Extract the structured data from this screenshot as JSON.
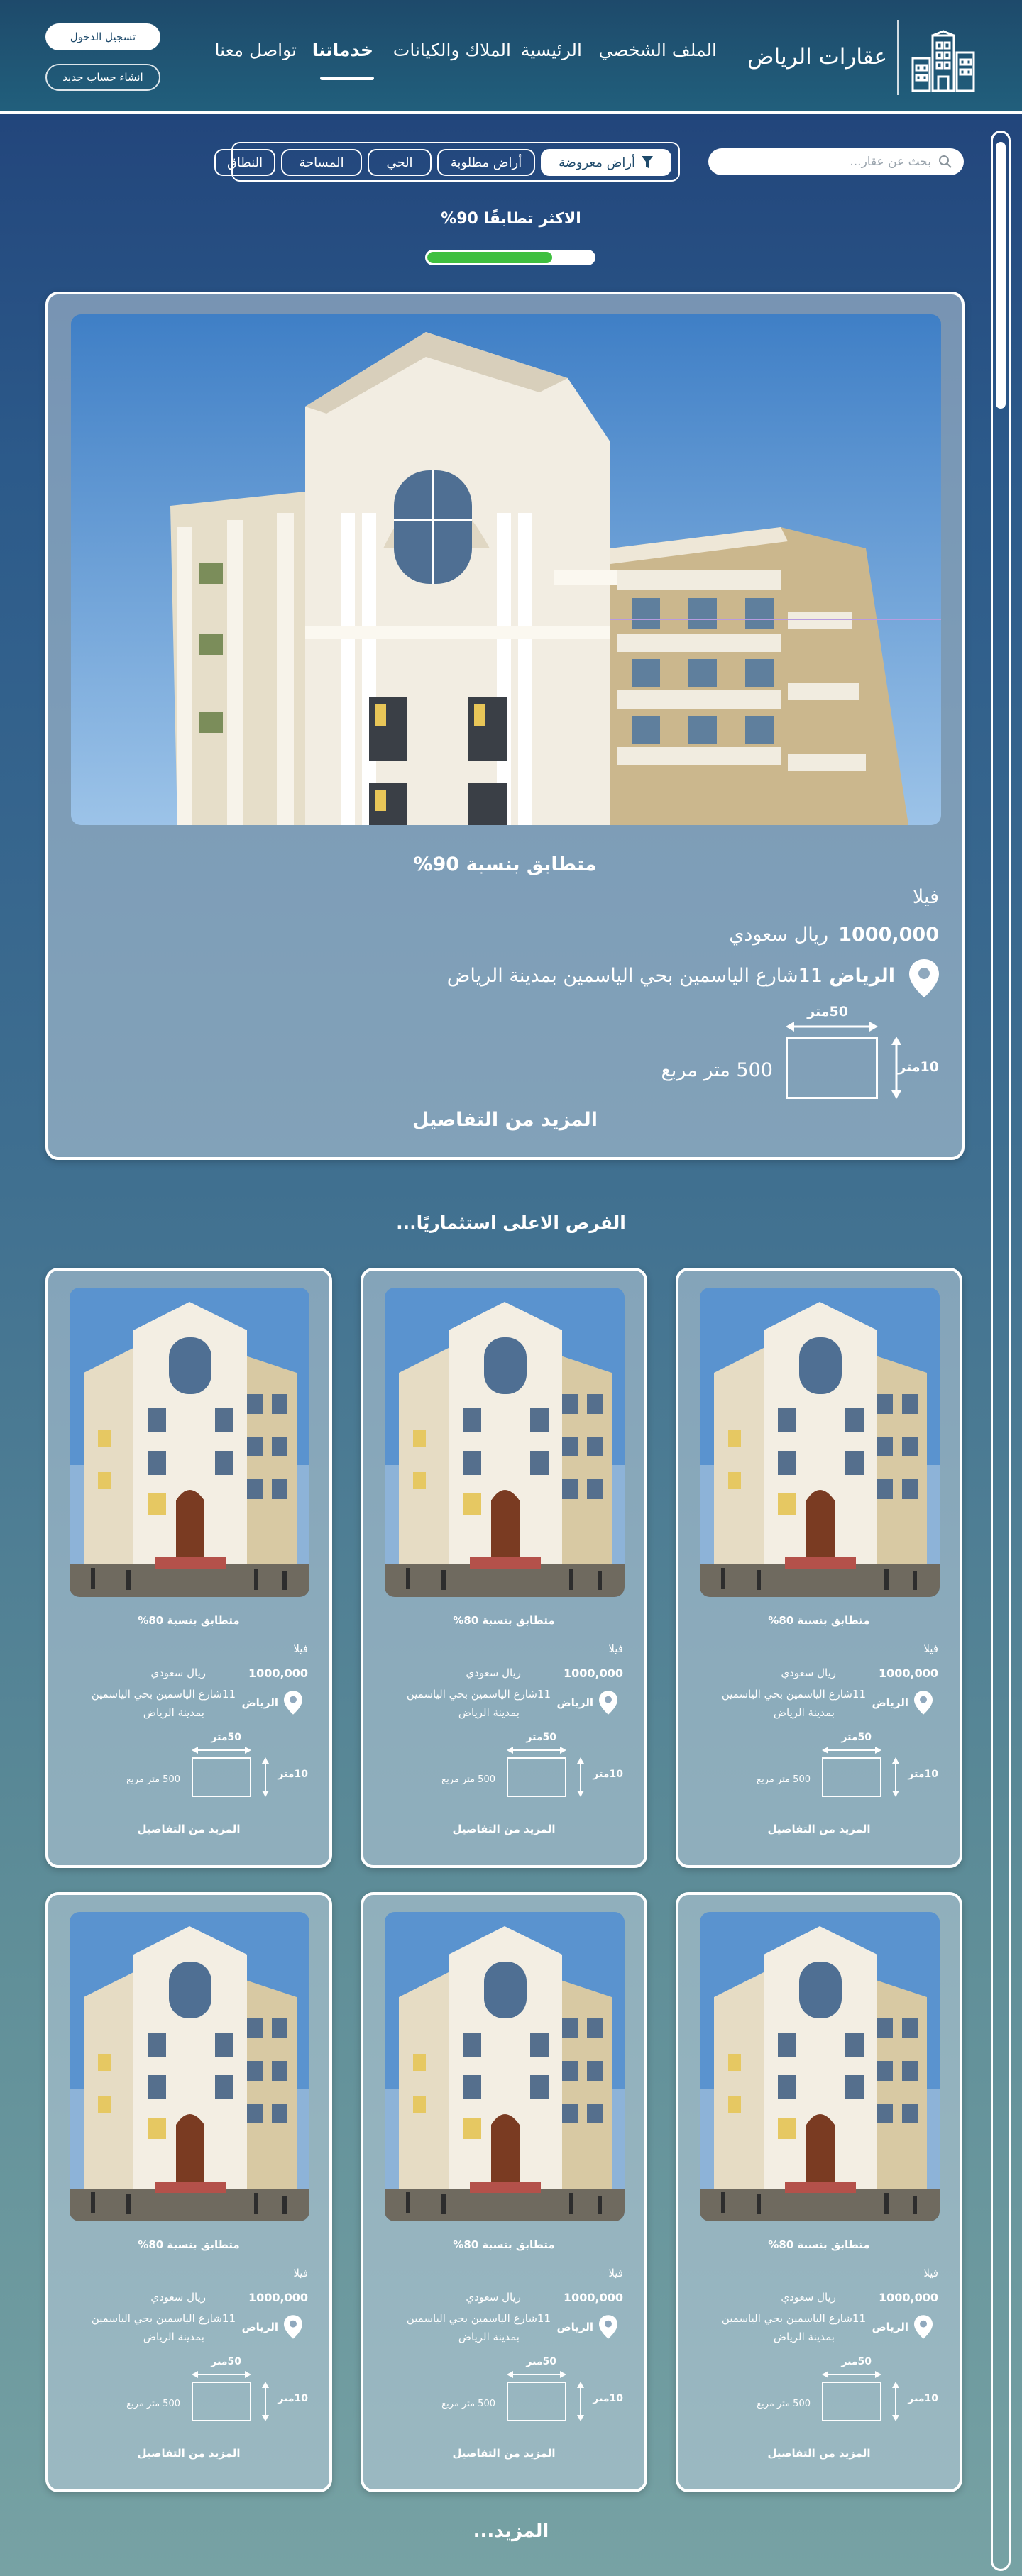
{
  "header": {
    "app_title": "عقارات الرياض",
    "nav": [
      "الملف الشخصي",
      "الرئيسية",
      "الملاك والكيانات",
      "خدماتنا",
      "تواصل معنا"
    ],
    "active_nav": "خدماتنا",
    "login_label": "تسجيل الدخول",
    "signup_label": "انشاء حساب جديد"
  },
  "search": {
    "placeholder": "بحث عن عقار..."
  },
  "filters": {
    "chips": [
      "أراض معروضة",
      "أراض مطلوبة",
      "الحي",
      "المساحة",
      "النطاق"
    ]
  },
  "top_match": {
    "label": "الاكثر تطابقًا 90%",
    "progress_percent": 75
  },
  "featured": {
    "match": "متطابق بنسبة 90%",
    "type": "فيلا",
    "price": "1000,000",
    "currency": "ريال سعودي",
    "city": "الرياض",
    "address": "11شارع الياسمين بحي الياسمين بمدينة الرياض",
    "width": "50متر",
    "height": "10متر",
    "area": "500 متر مربع",
    "details": "المزيد من التفاصيل"
  },
  "section_title": "الفرص الاعلى استثماريًا...",
  "listings": [
    {
      "match": "متطابق بنسبة 80%",
      "type": "فيلا",
      "price": "1000,000",
      "currency": "ريال سعودي",
      "city": "الرياض",
      "address_line1": "11شارع الياسمين بحي الياسمين",
      "address_line2": "بمدينة الرياض",
      "width": "50متر",
      "height": "10متر",
      "area": "500 متر مربع",
      "details": "المزيد من التفاصيل"
    },
    {
      "match": "متطابق بنسبة 80%",
      "type": "فيلا",
      "price": "1000,000",
      "currency": "ريال سعودي",
      "city": "الرياض",
      "address_line1": "11شارع الياسمين بحي الياسمين",
      "address_line2": "بمدينة الرياض",
      "width": "50متر",
      "height": "10متر",
      "area": "500 متر مربع",
      "details": "المزيد من التفاصيل"
    },
    {
      "match": "متطابق بنسبة 80%",
      "type": "فيلا",
      "price": "1000,000",
      "currency": "ريال سعودي",
      "city": "الرياض",
      "address_line1": "11شارع الياسمين بحي الياسمين",
      "address_line2": "بمدينة الرياض",
      "width": "50متر",
      "height": "10متر",
      "area": "500 متر مربع",
      "details": "المزيد من التفاصيل"
    },
    {
      "match": "متطابق بنسبة 80%",
      "type": "فيلا",
      "price": "1000,000",
      "currency": "ريال سعودي",
      "city": "الرياض",
      "address_line1": "11شارع الياسمين بحي الياسمين",
      "address_line2": "بمدينة الرياض",
      "width": "50متر",
      "height": "10متر",
      "area": "500 متر مربع",
      "details": "المزيد من التفاصيل"
    },
    {
      "match": "متطابق بنسبة 80%",
      "type": "فيلا",
      "price": "1000,000",
      "currency": "ريال سعودي",
      "city": "الرياض",
      "address_line1": "11شارع الياسمين بحي الياسمين",
      "address_line2": "بمدينة الرياض",
      "width": "50متر",
      "height": "10متر",
      "area": "500 متر مربع",
      "details": "المزيد من التفاصيل"
    },
    {
      "match": "متطابق بنسبة 80%",
      "type": "فيلا",
      "price": "1000,000",
      "currency": "ريال سعودي",
      "city": "الرياض",
      "address_line1": "11شارع الياسمين بحي الياسمين",
      "address_line2": "بمدينة الرياض",
      "width": "50متر",
      "height": "10متر",
      "area": "500 متر مربع",
      "details": "المزيد من التفاصيل"
    }
  ],
  "more_label": "المزيد...",
  "colors": {
    "header_bg": "#215f7c",
    "accent_green": "#3fbf3f",
    "card_bg": "#b9ccda",
    "text": "#ffffff"
  }
}
